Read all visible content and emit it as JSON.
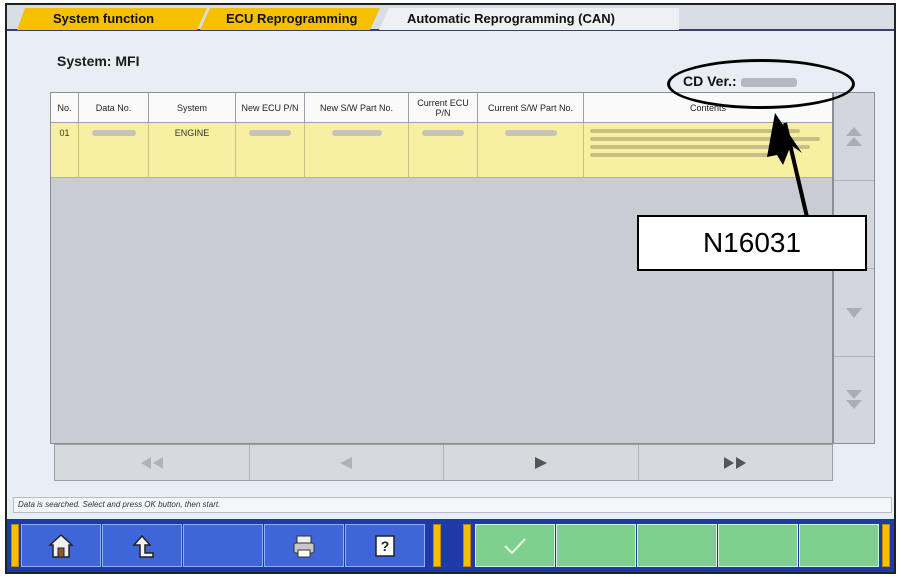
{
  "tabs": [
    {
      "label": "System function"
    },
    {
      "label": "ECU Reprogramming"
    },
    {
      "label": "Automatic Reprogramming (CAN)"
    }
  ],
  "system_title": "System: MFI",
  "cd_version_label": "CD Ver.:",
  "table": {
    "headers": [
      "No.",
      "Data No.",
      "System",
      "New ECU P/N",
      "New S/W Part No.",
      "Current ECU P/N",
      "Current S/W Part No.",
      "Contents"
    ],
    "rows": [
      {
        "no": "01",
        "system": "ENGINE"
      }
    ]
  },
  "status_message": "Data is searched. Select and press OK button, then start.",
  "annotation_label": "N16031",
  "icons": {
    "home": "home-icon",
    "back": "back-icon",
    "print": "printer-icon",
    "help": "help-icon",
    "ok": "checkmark-icon"
  },
  "colors": {
    "tab_active": "#f5c000",
    "row_highlight": "#f7f0a0",
    "toolbar": "#1e3aa8",
    "toolbar_button": "#3f66d8",
    "ok_button": "#7fcf8e"
  }
}
